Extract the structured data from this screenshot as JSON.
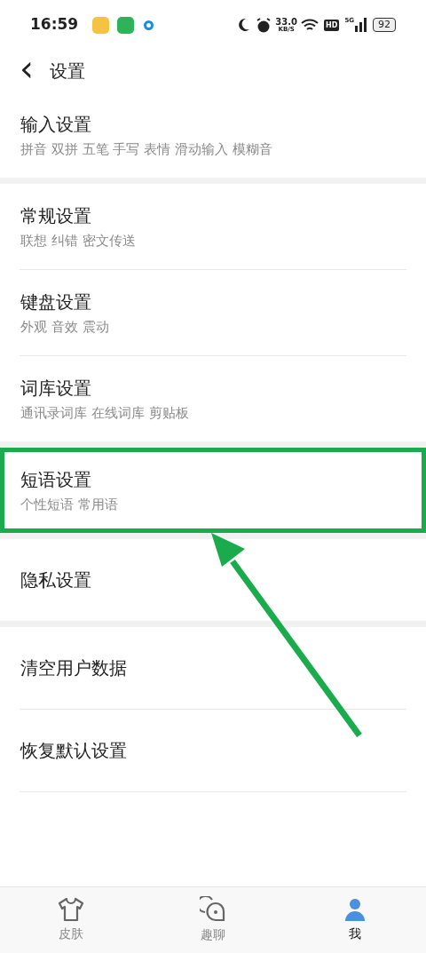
{
  "status_bar": {
    "time": "16:59",
    "speed": "33.0",
    "speed_unit": "KB/S",
    "hd": "HD",
    "network": "5G",
    "battery": "92"
  },
  "header": {
    "back": "‹",
    "title": "设置"
  },
  "groups": [
    {
      "items": [
        {
          "title": "输入设置",
          "subtitle": "拼音 双拼 五笔 手写 表情 滑动输入 模糊音",
          "highlighted": false
        }
      ]
    },
    {
      "items": [
        {
          "title": "常规设置",
          "subtitle": "联想 纠错 密文传送",
          "highlighted": false
        },
        {
          "title": "键盘设置",
          "subtitle": "外观 音效 震动",
          "highlighted": false
        },
        {
          "title": "词库设置",
          "subtitle": "通讯录词库 在线词库 剪贴板",
          "highlighted": false
        }
      ]
    },
    {
      "items": [
        {
          "title": "短语设置",
          "subtitle": "个性短语 常用语",
          "highlighted": true
        }
      ]
    },
    {
      "items": [
        {
          "title": "隐私设置",
          "highlighted": false
        }
      ]
    },
    {
      "items": [
        {
          "title": "清空用户数据",
          "highlighted": false
        },
        {
          "title": "恢复默认设置",
          "highlighted": false
        }
      ]
    }
  ],
  "bottom_nav": [
    {
      "label": "皮肤",
      "kind": "shirt",
      "selected": false
    },
    {
      "label": "趣聊",
      "kind": "chat",
      "selected": false
    },
    {
      "label": "我",
      "kind": "person",
      "selected": true
    }
  ]
}
